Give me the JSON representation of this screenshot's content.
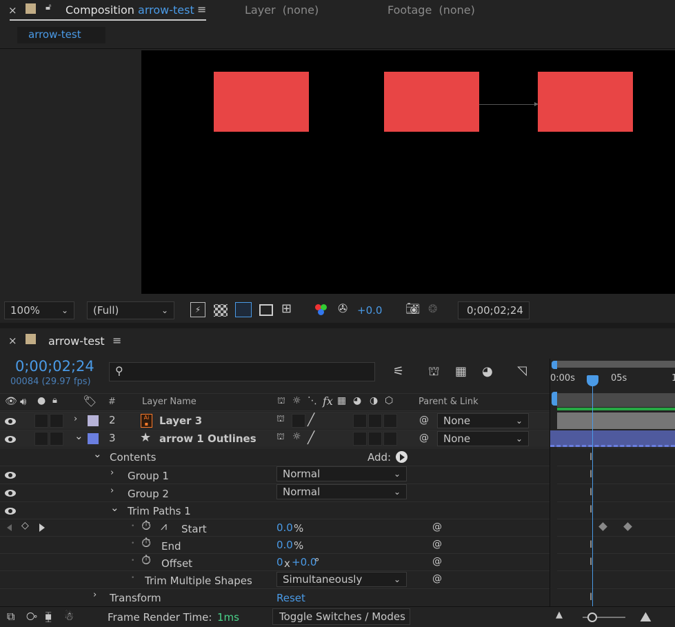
{
  "tabs": {
    "composition": {
      "prefix": "Composition",
      "name": "arrow-test"
    },
    "layer": "Layer  (none)",
    "footage": "Footage  (none)",
    "subtab": "arrow-test"
  },
  "viewer_toolbar": {
    "zoom": "100%",
    "resolution": "(Full)",
    "exposure": "+0.0",
    "timecode": "0;00;02;24"
  },
  "timeline": {
    "panel_title": "arrow-test",
    "current_time": "0;00;02;24",
    "frame_info": "00084 (29.97 fps)",
    "search_placeholder": "",
    "ruler": {
      "t0": "0:00s",
      "t1": "05s",
      "t2": "1"
    },
    "headers": {
      "hash": "#",
      "layer_name": "Layer Name",
      "parent_link": "Parent & Link"
    },
    "layers": [
      {
        "num": "2",
        "name": "Layer 3",
        "parent": "None",
        "label_color": "#b7b3d8"
      },
      {
        "num": "3",
        "name": "arrow 1 Outlines",
        "parent": "None",
        "label_color": "#6b7fe0"
      }
    ],
    "contents": {
      "label": "Contents",
      "add_label": "Add:"
    },
    "groups": [
      {
        "name": "Group 1",
        "blend": "Normal"
      },
      {
        "name": "Group 2",
        "blend": "Normal"
      }
    ],
    "trim": {
      "label": "Trim Paths 1",
      "start_label": "Start",
      "start_value": "0.0",
      "start_unit": "%",
      "end_label": "End",
      "end_value": "0.0",
      "end_unit": "%",
      "offset_label": "Offset",
      "offset_x": "0",
      "offset_mult": "x",
      "offset_value": "+0.0",
      "offset_unit": "°",
      "multi_label": "Trim Multiple Shapes",
      "multi_value": "Simultaneously"
    },
    "transform": {
      "label": "Transform",
      "reset": "Reset"
    }
  },
  "status_bar": {
    "render_label": "Frame Render Time:",
    "render_value": "1ms",
    "toggle": "Toggle Switches / Modes"
  },
  "colors": {
    "accent": "#4a9ae6",
    "shape_red": "#e84545",
    "label_layer3": "#b7b3d8",
    "label_arrow": "#6b7fe0",
    "green_bar": "#27a844"
  }
}
